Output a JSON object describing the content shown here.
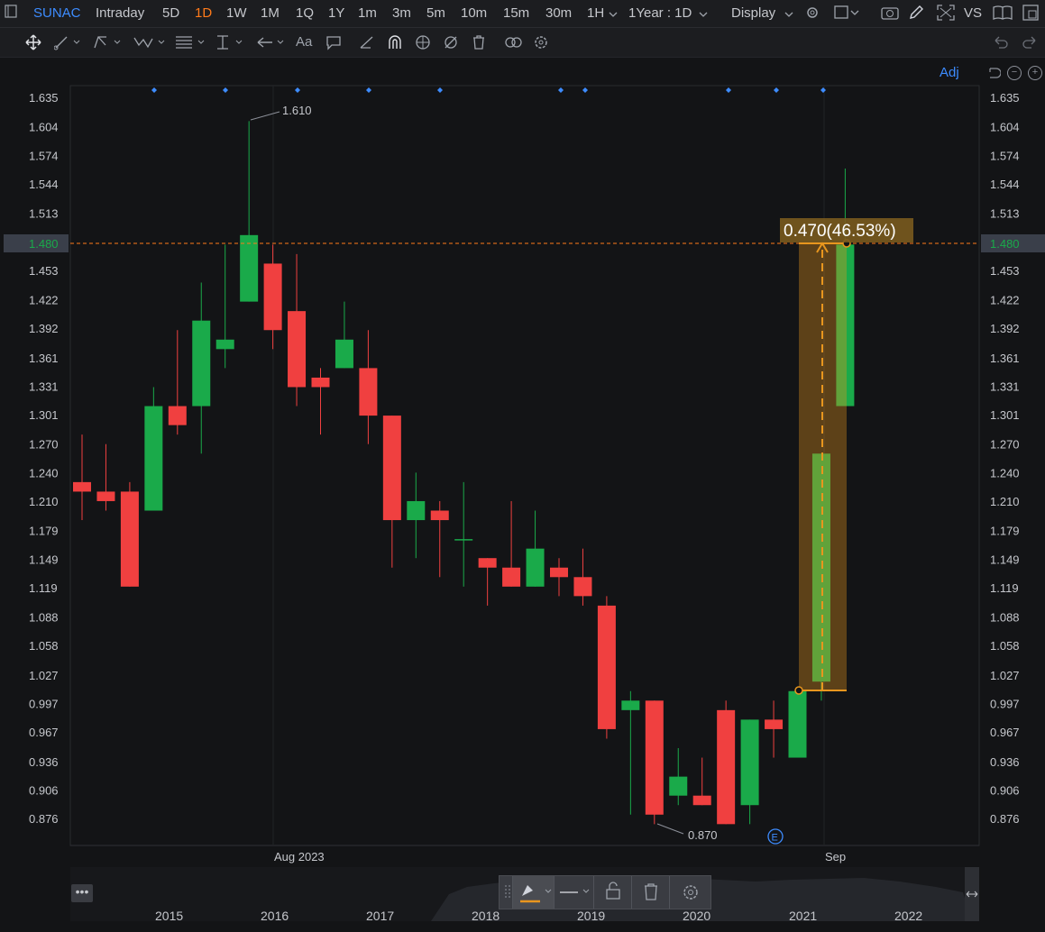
{
  "toolbar": {
    "symbol": "SUNAC",
    "intervals": [
      "Intraday",
      "5D",
      "1D",
      "1W",
      "1M",
      "1Q",
      "1Y",
      "1m",
      "3m",
      "5m",
      "10m",
      "15m",
      "30m",
      "1H"
    ],
    "active_interval": "1D",
    "range": "1Year : 1D",
    "display": "Display",
    "vs": "VS"
  },
  "chart_header": {
    "adj": "Adj"
  },
  "price_axis": [
    "1.635",
    "1.604",
    "1.574",
    "1.544",
    "1.513",
    "1.480",
    "1.453",
    "1.422",
    "1.392",
    "1.361",
    "1.331",
    "1.301",
    "1.270",
    "1.240",
    "1.210",
    "1.179",
    "1.149",
    "1.119",
    "1.088",
    "1.058",
    "1.027",
    "0.997",
    "0.967",
    "0.936",
    "0.906",
    "0.876"
  ],
  "current_price": "1.480",
  "date_axis": [
    "Aug 2023",
    "Sep"
  ],
  "annotations": {
    "high": "1.610",
    "low": "0.870",
    "measure": "0.470(46.53%)",
    "event": "E"
  },
  "navigator_years": [
    "2015",
    "2016",
    "2017",
    "2018",
    "2019",
    "2020",
    "2021",
    "2022"
  ],
  "colors": {
    "up": "#1aaa4a",
    "down": "#f04040",
    "accent": "#ff7a1a",
    "link": "#3d8cff",
    "measure": "#e8961e"
  },
  "chart_data": {
    "type": "candlestick",
    "ylim": [
      0.86,
      1.65
    ],
    "candles": [
      {
        "o": 1.23,
        "h": 1.28,
        "l": 1.19,
        "c": 1.22
      },
      {
        "o": 1.22,
        "h": 1.27,
        "l": 1.2,
        "c": 1.21
      },
      {
        "o": 1.22,
        "h": 1.23,
        "l": 1.12,
        "c": 1.12
      },
      {
        "o": 1.2,
        "h": 1.33,
        "l": 1.2,
        "c": 1.31
      },
      {
        "o": 1.31,
        "h": 1.39,
        "l": 1.28,
        "c": 1.29
      },
      {
        "o": 1.31,
        "h": 1.44,
        "l": 1.26,
        "c": 1.4
      },
      {
        "o": 1.37,
        "h": 1.48,
        "l": 1.35,
        "c": 1.38
      },
      {
        "o": 1.42,
        "h": 1.61,
        "l": 1.42,
        "c": 1.49
      },
      {
        "o": 1.46,
        "h": 1.48,
        "l": 1.37,
        "c": 1.39
      },
      {
        "o": 1.41,
        "h": 1.47,
        "l": 1.31,
        "c": 1.33
      },
      {
        "o": 1.34,
        "h": 1.35,
        "l": 1.28,
        "c": 1.33
      },
      {
        "o": 1.35,
        "h": 1.42,
        "l": 1.35,
        "c": 1.38
      },
      {
        "o": 1.35,
        "h": 1.39,
        "l": 1.27,
        "c": 1.3
      },
      {
        "o": 1.3,
        "h": 1.3,
        "l": 1.14,
        "c": 1.19
      },
      {
        "o": 1.19,
        "h": 1.24,
        "l": 1.15,
        "c": 1.21
      },
      {
        "o": 1.2,
        "h": 1.21,
        "l": 1.13,
        "c": 1.19
      },
      {
        "o": 1.17,
        "h": 1.23,
        "l": 1.12,
        "c": 1.17
      },
      {
        "o": 1.15,
        "h": 1.15,
        "l": 1.1,
        "c": 1.14
      },
      {
        "o": 1.14,
        "h": 1.21,
        "l": 1.12,
        "c": 1.12
      },
      {
        "o": 1.12,
        "h": 1.2,
        "l": 1.12,
        "c": 1.16
      },
      {
        "o": 1.14,
        "h": 1.15,
        "l": 1.11,
        "c": 1.13
      },
      {
        "o": 1.13,
        "h": 1.16,
        "l": 1.1,
        "c": 1.11
      },
      {
        "o": 1.1,
        "h": 1.11,
        "l": 0.96,
        "c": 0.97
      },
      {
        "o": 0.99,
        "h": 1.01,
        "l": 0.88,
        "c": 1.0
      },
      {
        "o": 1.0,
        "h": 1.0,
        "l": 0.87,
        "c": 0.88
      },
      {
        "o": 0.9,
        "h": 0.95,
        "l": 0.89,
        "c": 0.92
      },
      {
        "o": 0.9,
        "h": 0.94,
        "l": 0.89,
        "c": 0.89
      },
      {
        "o": 0.99,
        "h": 1.0,
        "l": 0.87,
        "c": 0.87
      },
      {
        "o": 0.89,
        "h": 0.98,
        "l": 0.87,
        "c": 0.98
      },
      {
        "o": 0.98,
        "h": 1.0,
        "l": 0.94,
        "c": 0.97
      },
      {
        "o": 0.94,
        "h": 1.01,
        "l": 0.94,
        "c": 1.01
      },
      {
        "o": 1.02,
        "h": 1.05,
        "l": 1.0,
        "c": 1.26
      },
      {
        "o": 1.31,
        "h": 1.56,
        "l": 1.31,
        "c": 1.48
      }
    ]
  }
}
